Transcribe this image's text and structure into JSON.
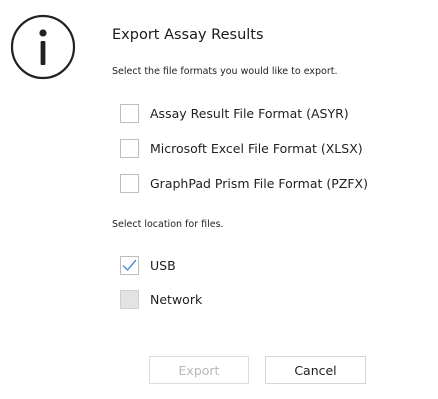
{
  "dialog": {
    "title": "Export Assay Results",
    "icon": "info-icon",
    "formats_instruction": "Select the file formats you would like to export.",
    "formats": [
      {
        "label": "Assay Result File Format (ASYR)",
        "checked": false,
        "enabled": true
      },
      {
        "label": "Microsoft Excel File Format (XLSX)",
        "checked": false,
        "enabled": true
      },
      {
        "label": "GraphPad Prism File Format (PZFX)",
        "checked": false,
        "enabled": true
      }
    ],
    "location_instruction": "Select location for files.",
    "locations": [
      {
        "label": "USB",
        "checked": true,
        "enabled": true
      },
      {
        "label": "Network",
        "checked": false,
        "enabled": false
      }
    ],
    "buttons": {
      "export_label": "Export",
      "export_enabled": false,
      "cancel_label": "Cancel"
    }
  },
  "colors": {
    "check_mark": "#4a90d9",
    "disabled_button_text": "#b8b8b8",
    "disabled_checkbox_fill": "#e3e3e3"
  }
}
